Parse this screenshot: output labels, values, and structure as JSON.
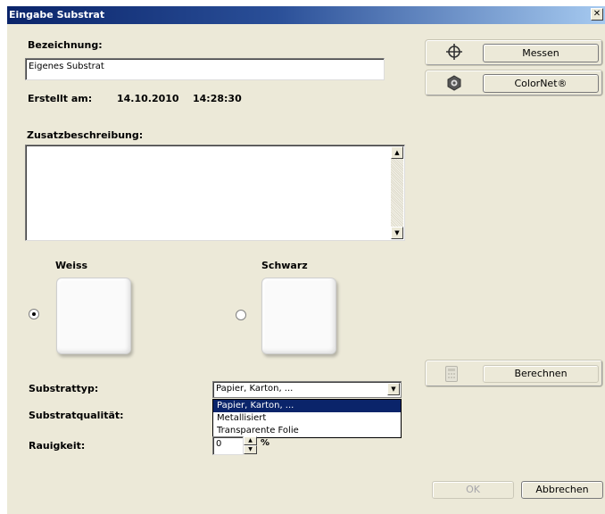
{
  "window": {
    "title": "Eingabe Substrat",
    "close_glyph": "✕"
  },
  "form": {
    "bezeichnung_label": "Bezeichnung:",
    "bezeichnung_value": "Eigenes Substrat",
    "erstellt_label": "Erstellt am:",
    "erstellt_date": "14.10.2010",
    "erstellt_time": "14:28:30",
    "zusatz_label": "Zusatzbeschreibung:",
    "zusatz_value": ""
  },
  "reference": {
    "weiss_label": "Weiss",
    "schwarz_label": "Schwarz",
    "selected": "Weiss"
  },
  "right_panel": {
    "messen_label": "Messen",
    "colornet_label": "ColorNet®",
    "berechnen_label": "Berechnen",
    "icons": [
      "crosshair-icon",
      "colornet-logo-icon",
      "calculator-icon"
    ]
  },
  "substrate": {
    "typ_label": "Substrattyp:",
    "typ_value": "Papier, Karton, ...",
    "options": [
      "Papier, Karton, ...",
      "Metallisiert",
      "Transparente Folie"
    ],
    "qualitaet_label": "Substratqualität:",
    "rauigkeit_label": "Rauigkeit:",
    "rauigkeit_value": "0",
    "rauigkeit_unit": "%"
  },
  "footer": {
    "ok_label": "OK",
    "cancel_label": "Abbrechen"
  },
  "colors": {
    "titlebar_start": "#0a246a",
    "titlebar_end": "#a6caf0",
    "dialog_bg": "#ece9d8",
    "selection": "#0a246a"
  }
}
